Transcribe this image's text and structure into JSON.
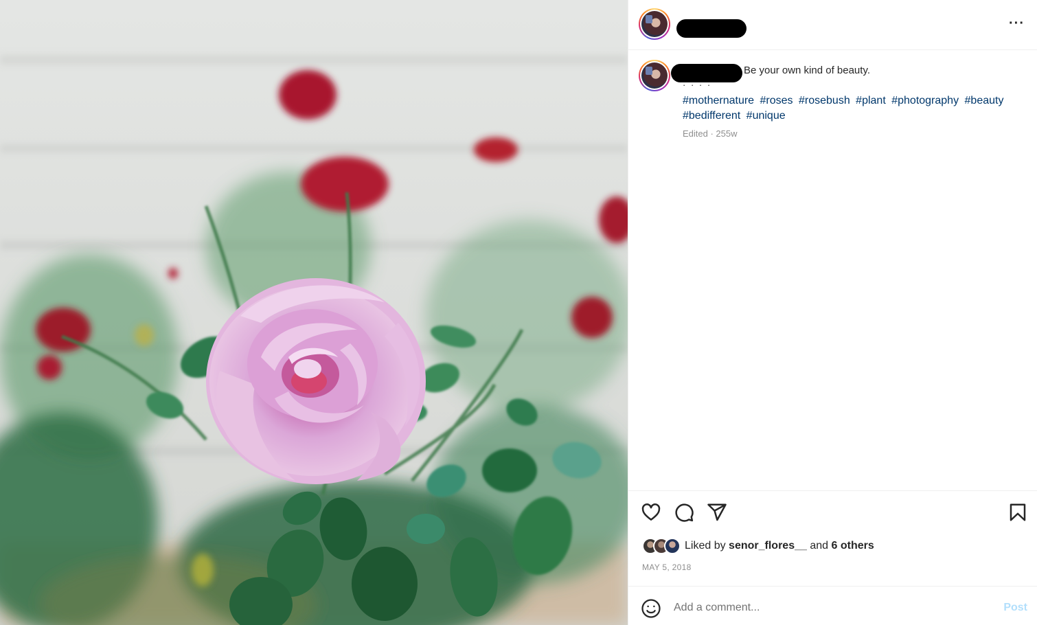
{
  "post": {
    "caption": "Be your own kind of beauty.",
    "caption_dots": "· · · ·",
    "hashtags": [
      "#mothernature",
      "#roses",
      "#rosebush",
      "#plant",
      "#photography",
      "#beauty",
      "#bedifferent",
      "#unique"
    ],
    "meta": "Edited · 255w",
    "more_label": "···"
  },
  "likes": {
    "prefix": "Liked by",
    "user": "senor_flores__",
    "conjunction": "and",
    "others": "6 others"
  },
  "date": "MAY 5, 2018",
  "comment": {
    "placeholder": "Add a comment...",
    "post_label": "Post"
  },
  "icons": {
    "like": "heart-icon",
    "comment": "comment-icon",
    "share": "share-icon",
    "save": "bookmark-icon",
    "emoji": "emoji-icon",
    "more": "more-options-icon"
  },
  "colors": {
    "hashtag": "#00376b",
    "post_disabled": "#b2dffc",
    "muted": "#8e8e8e",
    "rose": "#d8a6d4"
  }
}
